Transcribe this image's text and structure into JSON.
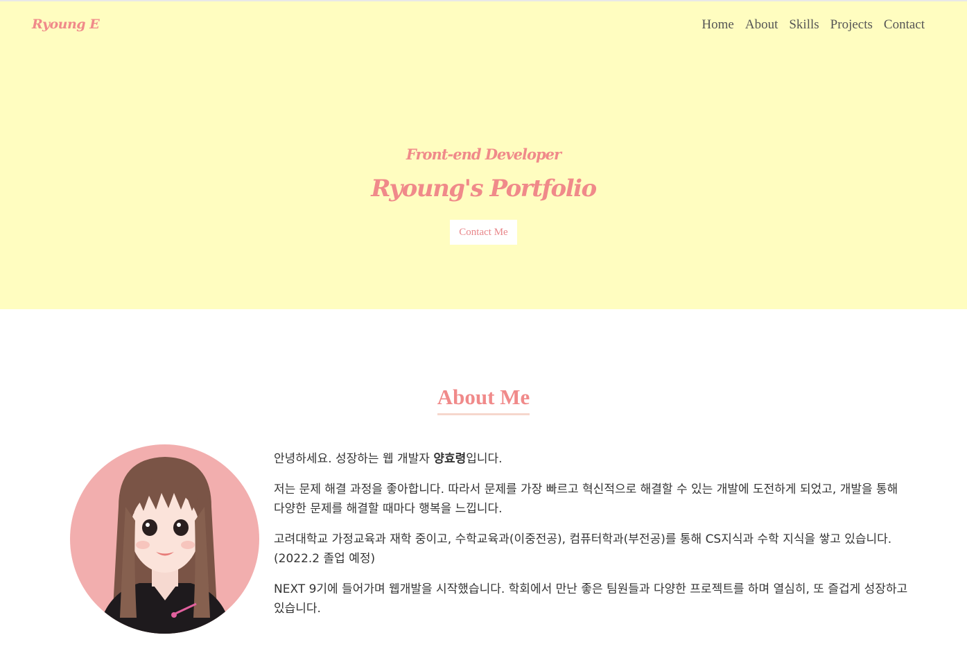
{
  "header": {
    "logo": "Ryoung E",
    "nav": [
      {
        "label": "Home"
      },
      {
        "label": "About"
      },
      {
        "label": "Skills"
      },
      {
        "label": "Projects"
      },
      {
        "label": "Contact"
      }
    ]
  },
  "hero": {
    "subtitle": "Front-end Developer",
    "title": "Ryoung's Portfolio",
    "contact_button": "Contact Me",
    "background_color": "#fffdc0",
    "accent_color": "#f08a8a"
  },
  "about": {
    "title": "About Me",
    "avatar_icon": "avatar-illustration",
    "paragraph1_prefix": "안녕하세요. 성장하는 웹 개발자 ",
    "paragraph1_name": "양효령",
    "paragraph1_suffix": "입니다.",
    "paragraph2": "저는 문제 해결 과정을 좋아합니다. 따라서 문제를 가장 빠르고 혁신적으로 해결할 수 있는 개발에 도전하게 되었고, 개발을 통해 다양한 문제를 해결할 때마다 행복을 느낍니다.",
    "paragraph3": "고려대학교 가정교육과 재학 중이고, 수학교육과(이중전공), 컴퓨터학과(부전공)를 통해 CS지식과 수학 지식을 쌓고 있습니다. (2022.2 졸업 예정)",
    "paragraph4": "NEXT 9기에 들어가며 웹개발을 시작했습니다. 학회에서 만난 좋은 팀원들과 다양한 프로젝트를 하며 열심히, 또 즐겁게 성장하고 있습니다."
  }
}
